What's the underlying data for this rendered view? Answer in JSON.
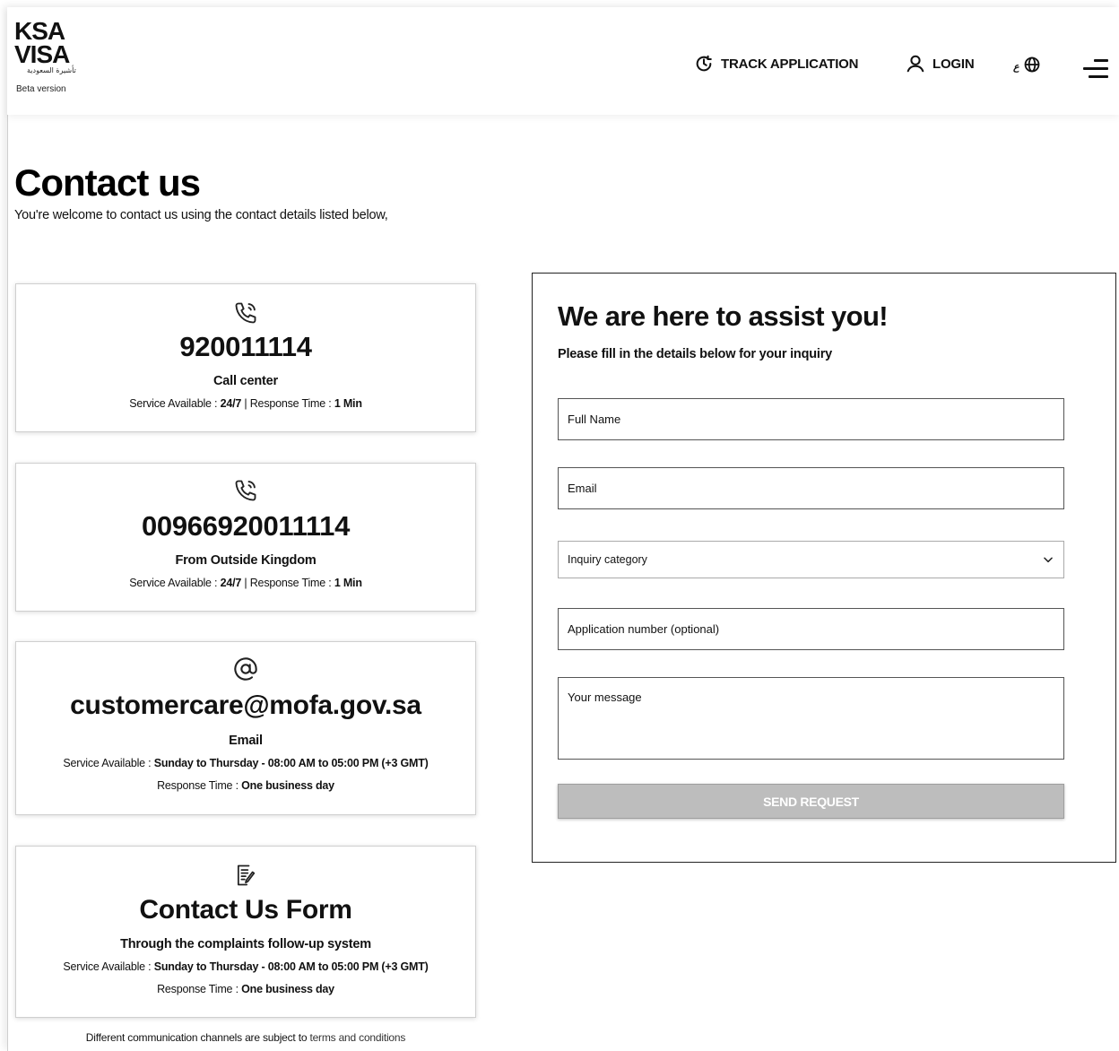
{
  "header": {
    "logo": {
      "line1": "KSA",
      "line2": "VISA",
      "arabic": "تأشيرة السعودية",
      "beta": "Beta version"
    },
    "nav": {
      "track": "TRACK APPLICATION",
      "login": "LOGIN",
      "lang": "ع"
    }
  },
  "page": {
    "title": "Contact us",
    "subtitle": "You're welcome to contact us using the contact details listed below,"
  },
  "cards": [
    {
      "icon": "phone-call-icon",
      "value": "920011114",
      "label": "Call center",
      "info_prefix": "Service Available : ",
      "info_bold": "24/7",
      "info_mid": " | Response Time : ",
      "info_bold2": "1 Min"
    },
    {
      "icon": "phone-call-icon",
      "value": "00966920011114",
      "label": "From Outside Kingdom",
      "info_prefix": "Service Available : ",
      "info_bold": "24/7",
      "info_mid": " | Response Time : ",
      "info_bold2": "1 Min"
    },
    {
      "icon": "at-sign-icon",
      "value": "customercare@mofa.gov.sa",
      "label": "Email",
      "info_prefix": "Service Available : ",
      "info_bold": "Sunday to Thursday - 08:00 AM to 05:00 PM (+3 GMT)",
      "info2_prefix": "Response Time : ",
      "info2_bold": "One business day"
    },
    {
      "icon": "form-edit-icon",
      "value": "Contact Us Form",
      "label": "Through the complaints follow-up system",
      "info_prefix": "Service Available : ",
      "info_bold": "Sunday to Thursday - 08:00 AM to 05:00 PM (+3 GMT)",
      "info2_prefix": "Response Time : ",
      "info2_bold": "One business day"
    }
  ],
  "footnote": {
    "text": "Different communication channels are subject to ",
    "link": "terms and conditions"
  },
  "form": {
    "title": "We are here to assist you!",
    "subtitle": "Please fill in the details below for your inquiry",
    "full_name_placeholder": "Full Name",
    "email_placeholder": "Email",
    "category_selected": "Inquiry category",
    "application_placeholder": "Application number (optional)",
    "message_placeholder": "Your message",
    "submit_label": "SEND REQUEST"
  },
  "colors": {
    "submit_disabled": "#bdbdbd",
    "text": "#111111",
    "border": "#cfcfcf"
  }
}
